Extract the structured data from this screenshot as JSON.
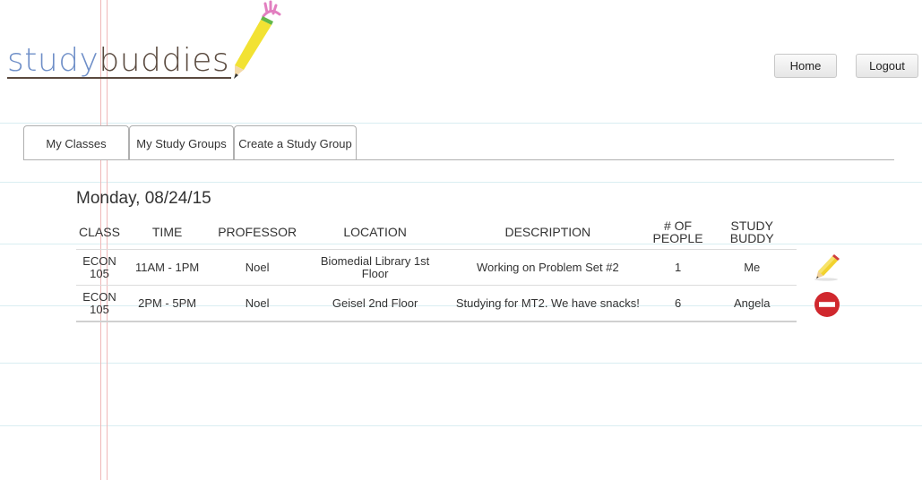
{
  "app": {
    "logo_part1": "study",
    "logo_part2": "buddies"
  },
  "header": {
    "home_label": "Home",
    "logout_label": "Logout"
  },
  "tabs": [
    {
      "label": "My Classes"
    },
    {
      "label": "My Study Groups"
    },
    {
      "label": "Create a Study Group"
    }
  ],
  "date_heading": "Monday, 08/24/15",
  "table": {
    "headers": {
      "class": "CLASS",
      "time": "TIME",
      "professor": "PROFESSOR",
      "location": "LOCATION",
      "description": "DESCRIPTION",
      "num_people_line1": "# OF",
      "num_people_line2": "PEOPLE",
      "study_buddy": "STUDY BUDDY"
    },
    "rows": [
      {
        "class_line1": "ECON",
        "class_line2": "105",
        "time": "11AM - 1PM",
        "professor": "Noel",
        "location_line1": "Biomedial Library 1st",
        "location_line2": "Floor",
        "description": "Working on Problem Set #2",
        "num_people": "1",
        "study_buddy": "Me",
        "action_icon": "pencil-edit-icon"
      },
      {
        "class_line1": "ECON",
        "class_line2": "105",
        "time": "2PM - 5PM",
        "professor": "Noel",
        "location_line1": "Geisel 2nd Floor",
        "location_line2": "",
        "description": "Studying for MT2. We have snacks!",
        "num_people": "6",
        "study_buddy": "Angela",
        "action_icon": "remove-minus-icon"
      }
    ]
  },
  "colors": {
    "paper_line": "#d9eef2",
    "margin_line": "#f0b8b8",
    "logo_blue": "#6f8fc8",
    "logo_brown": "#5a4a3f",
    "remove_red": "#d0282e",
    "pencil_yellow": "#f2d22e"
  }
}
